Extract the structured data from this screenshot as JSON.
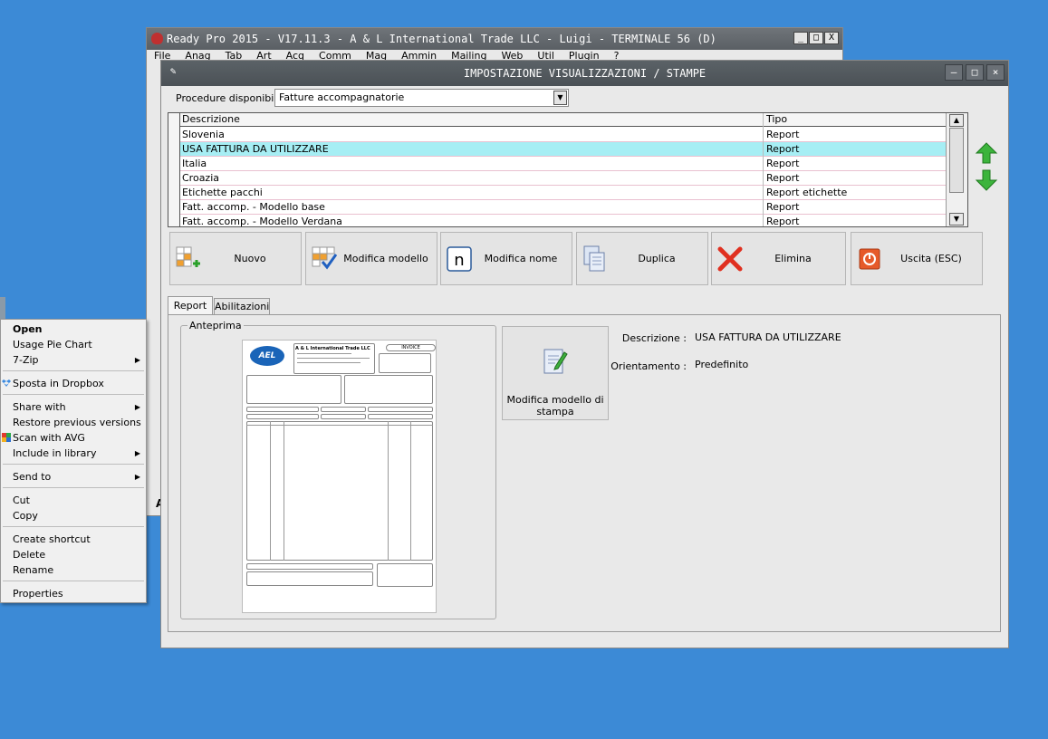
{
  "background_window": {
    "title": "Ready Pro 2015 - V17.11.3 - A & L International Trade LLC - Luigi - TERMINALE 56 (D)",
    "menu": [
      "File",
      "Anag",
      "Tab",
      "Art",
      "Acq",
      "Comm",
      "Mag",
      "Ammin",
      "Mailing",
      "Web",
      "Util",
      "Plugin",
      "?"
    ],
    "controls": [
      "_",
      "□",
      "X"
    ],
    "strip_letter": "A"
  },
  "context_menu": {
    "items": [
      {
        "label": "Open",
        "bold": true
      },
      {
        "label": "Usage Pie Chart"
      },
      {
        "label": "7-Zip",
        "submenu": true
      },
      {
        "label": "Sposta in Dropbox",
        "icon": "dropbox-icon"
      },
      {
        "label": "Share with",
        "submenu": true
      },
      {
        "label": "Restore previous versions"
      },
      {
        "label": "Scan with AVG",
        "icon": "avg-icon"
      },
      {
        "label": "Include in library",
        "submenu": true
      },
      {
        "label": "Send to",
        "submenu": true
      },
      {
        "label": "Cut"
      },
      {
        "label": "Copy"
      },
      {
        "label": "Create shortcut"
      },
      {
        "label": "Delete"
      },
      {
        "label": "Rename"
      },
      {
        "label": "Properties"
      }
    ],
    "submenu_arrow": "▶"
  },
  "dialog": {
    "title": "IMPOSTAZIONE VISUALIZZAZIONI / STAMPE",
    "controls": [
      "–",
      "□",
      "×"
    ],
    "procedures_label": "Procedure disponibili :",
    "procedures_value": "Fatture accompagnatorie",
    "grid": {
      "columns": [
        "Descrizione",
        "Tipo"
      ],
      "rows": [
        {
          "descrizione": "Slovenia",
          "tipo": "Report"
        },
        {
          "descrizione": "USA FATTURA DA UTILIZZARE",
          "tipo": "Report",
          "selected": true
        },
        {
          "descrizione": "Italia",
          "tipo": "Report"
        },
        {
          "descrizione": "Croazia",
          "tipo": "Report"
        },
        {
          "descrizione": "Etichette pacchi",
          "tipo": "Report etichette"
        },
        {
          "descrizione": "Fatt. accomp. - Modello base",
          "tipo": "Report"
        },
        {
          "descrizione": "Fatt. accomp. - Modello Verdana",
          "tipo": "Report"
        }
      ]
    },
    "buttons": {
      "nuovo": "Nuovo",
      "modifica_modello": "Modifica modello",
      "modifica_nome": "Modifica nome",
      "duplica": "Duplica",
      "elimina": "Elimina",
      "uscita": "Uscita (ESC)"
    },
    "tabs": [
      "Report",
      "Abilitazioni"
    ],
    "preview_label": "Anteprima",
    "preview_doc": {
      "logo_text": "AEL",
      "company": "A & L International Trade LLC",
      "invoice_label": "INVOICE"
    },
    "edit_print_button": "Modifica modello di stampa",
    "details": {
      "descrizione_label": "Descrizione :",
      "descrizione_value": "USA FATTURA DA UTILIZZARE",
      "orientamento_label": "Orientamento :",
      "orientamento_value": "Predefinito"
    },
    "colors": {
      "selected_row": "#a6eef4",
      "title_bar": "#52585d"
    }
  }
}
